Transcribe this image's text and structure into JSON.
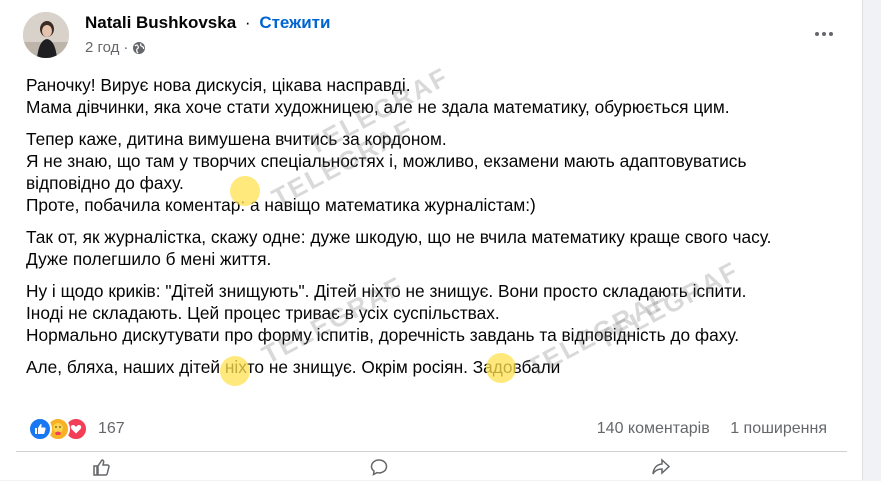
{
  "post": {
    "author": "Natali Bushkovska",
    "separator": "·",
    "follow_label": "Стежити",
    "time": "2 год",
    "meta_separator": "·",
    "privacy_icon": "globe-icon",
    "more_icon": "more-horizontal-icon"
  },
  "body": {
    "p1": [
      "Раночку! Вирує нова дискусія, цікава насправді.",
      "Мама дівчинки, яка хоче стати художницею, але не здала математику, обурюється цим."
    ],
    "p2": [
      "Тепер каже, дитина вимушена вчитись за кордоном.",
      "Я не знаю, що там у творчих спеціальностях і, можливо, екзамени мають адаптовуватись",
      "відповідно до фаху.",
      "Проте, побачила коментар: а навіщо математика журналістам:)"
    ],
    "p3": [
      "Так от, як журналістка, скажу одне: дуже шкодую, що не вчила математику краще свого часу.",
      "Дуже полегшило б мені життя."
    ],
    "p4": [
      "Ну і щодо криків: \"Дітей знищують\". Дітей ніхто не знищує. Вони просто складають іспити.",
      "Іноді не складають. Цей процес триває в усіх суспільствах.",
      "Нормально дискутувати про форму іспитів, доречність завдань та відповідність до фаху."
    ],
    "p5": [
      "Але, бляха, наших дітей ніхто не знищує. Окрім росіян. Задовбали"
    ]
  },
  "reactions": {
    "icons": [
      "like-icon",
      "care-icon",
      "love-icon"
    ],
    "count": "167"
  },
  "stats": {
    "comments": "140 коментарів",
    "shares": "1 поширення"
  },
  "watermark": {
    "text": "TELEGRAF"
  },
  "colors": {
    "link": "#0064d1",
    "secondary_text": "#65676b",
    "like": "#1877f2",
    "care": "#f7b125",
    "love": "#f33e58"
  }
}
